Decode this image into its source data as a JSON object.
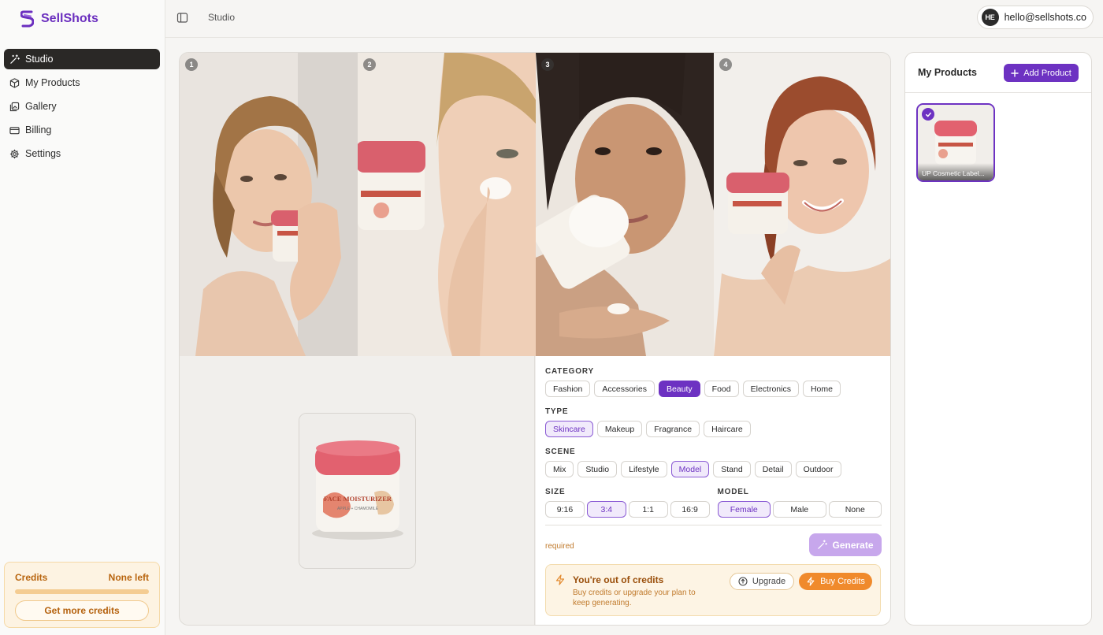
{
  "app": {
    "name": "SellShots",
    "brand_color": "#6b2fbf",
    "accent": "#6d32c2"
  },
  "sidebar": {
    "items": [
      {
        "label": "Studio",
        "icon": "magic-wand-icon",
        "active": true
      },
      {
        "label": "My Products",
        "icon": "box-icon",
        "active": false
      },
      {
        "label": "Gallery",
        "icon": "gallery-icon",
        "active": false
      },
      {
        "label": "Billing",
        "icon": "credit-card-icon",
        "active": false
      },
      {
        "label": "Settings",
        "icon": "gear-icon",
        "active": false
      }
    ],
    "credits": {
      "title": "Credits",
      "status": "None left",
      "button": "Get more credits"
    }
  },
  "topbar": {
    "breadcrumb": "Studio",
    "avatar_initials": "HE",
    "email": "hello@sellshots.co"
  },
  "studio": {
    "photos": [
      {
        "number": "1"
      },
      {
        "number": "2"
      },
      {
        "number": "3"
      },
      {
        "number": "4"
      }
    ],
    "controls": {
      "category": {
        "label": "CATEGORY",
        "options": [
          "Fashion",
          "Accessories",
          "Beauty",
          "Food",
          "Electronics",
          "Home"
        ],
        "selected": "Beauty"
      },
      "type": {
        "label": "TYPE",
        "options": [
          "Skincare",
          "Makeup",
          "Fragrance",
          "Haircare"
        ],
        "selected": "Skincare"
      },
      "scene": {
        "label": "SCENE",
        "options": [
          "Mix",
          "Studio",
          "Lifestyle",
          "Model",
          "Stand",
          "Detail",
          "Outdoor"
        ],
        "selected": "Model"
      },
      "size": {
        "label": "SIZE",
        "options": [
          "9:16",
          "3:4",
          "1:1",
          "16:9"
        ],
        "selected": "3:4"
      },
      "model": {
        "label": "MODEL",
        "options": [
          "Female",
          "Male",
          "None"
        ],
        "selected": "Female"
      },
      "required_text": "required",
      "generate_label": "Generate"
    },
    "out_of_credits": {
      "title": "You're out of credits",
      "subtitle": "Buy credits or upgrade your plan to keep generating.",
      "upgrade_label": "Upgrade",
      "buy_label": "Buy Credits"
    }
  },
  "products": {
    "title": "My Products",
    "add_label": "Add Product",
    "items": [
      {
        "name": "UP Cosmetic Label...",
        "selected": true
      }
    ]
  },
  "jar_label": {
    "title": "FACE MOISTURIZER",
    "subtitle": "APPLE + CHAMOMILE"
  }
}
